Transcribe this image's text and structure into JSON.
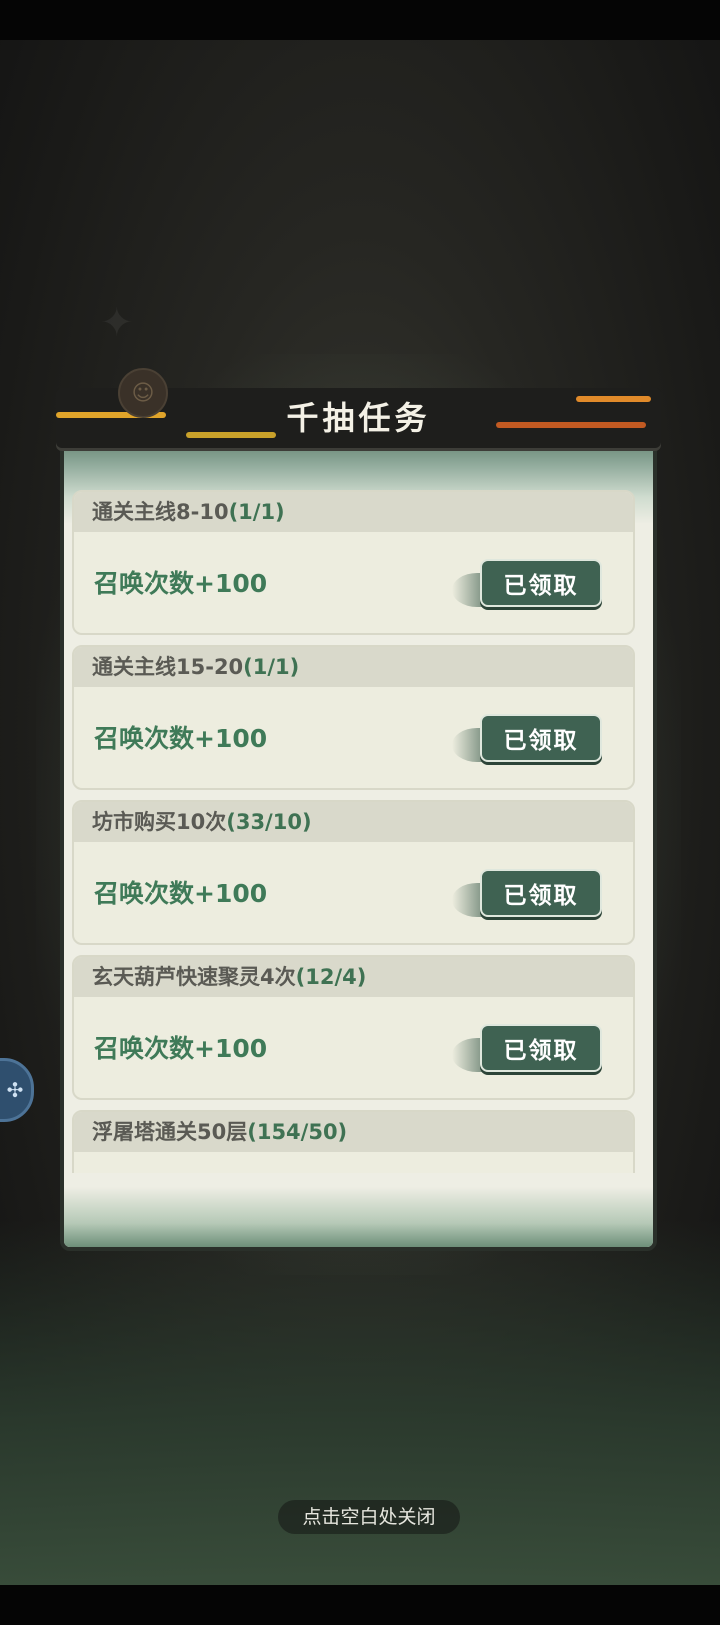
{
  "dialog": {
    "title": "千抽任务",
    "tasks": [
      {
        "name": "通关主线8-10",
        "progress": "(1/1)",
        "reward": "召唤次数+100",
        "button": "已领取"
      },
      {
        "name": "通关主线15-20",
        "progress": "(1/1)",
        "reward": "召唤次数+100",
        "button": "已领取"
      },
      {
        "name": "坊市购买10次",
        "progress": "(33/10)",
        "reward": "召唤次数+100",
        "button": "已领取"
      },
      {
        "name": "玄天葫芦快速聚灵4次",
        "progress": "(12/4)",
        "reward": "召唤次数+100",
        "button": "已领取"
      },
      {
        "name": "浮屠塔通关50层",
        "progress": "(154/50)"
      }
    ]
  },
  "close_hint": "点击空白处关闭",
  "colors": {
    "accent_green": "#3f7a58",
    "button_green": "#3f6252",
    "panel": "#eeeee4"
  },
  "icons": {
    "side_button": "gamepad-icon",
    "header_mascot": "monkey-icon"
  }
}
